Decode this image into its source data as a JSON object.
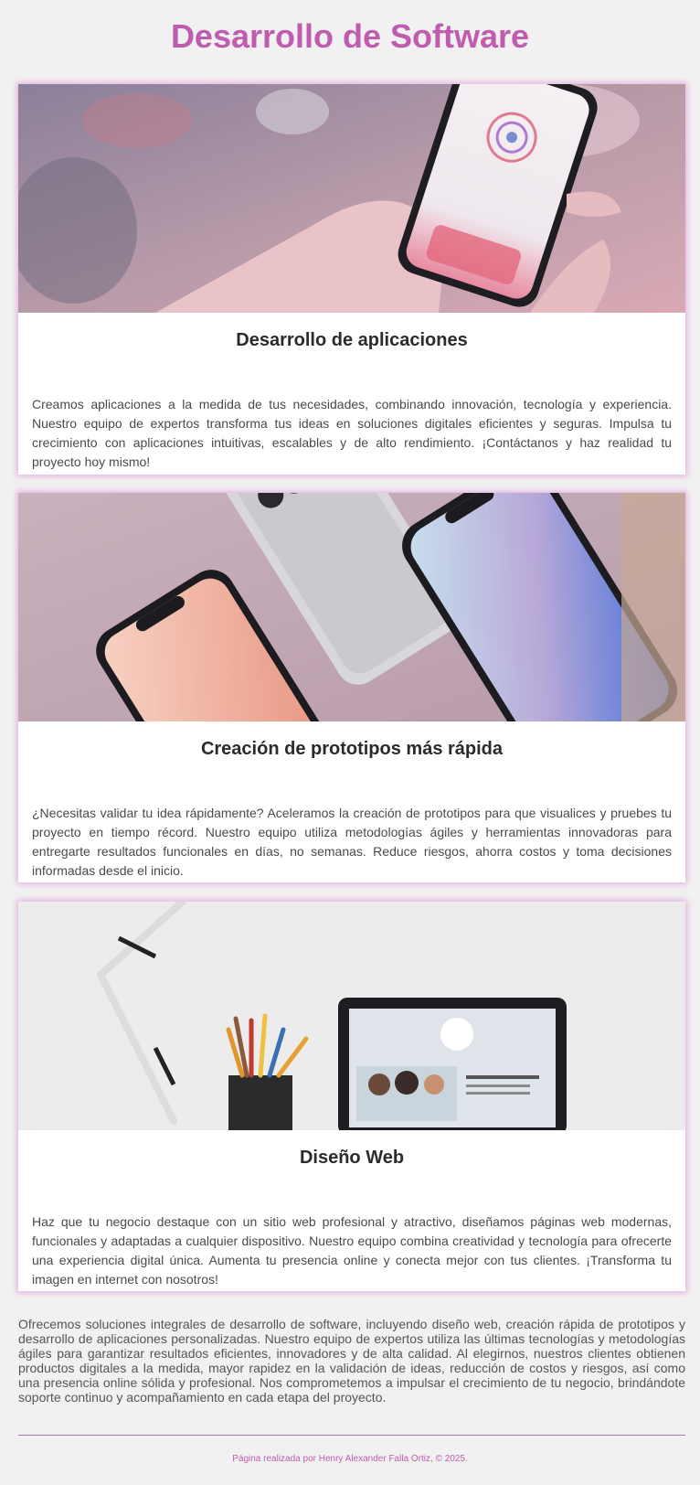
{
  "page": {
    "title": "Desarrollo de Software"
  },
  "cards": [
    {
      "image_alt": "Mano sosteniendo un smartphone con una aplicación",
      "heading": "Desarrollo de aplicaciones",
      "text": "Creamos aplicaciones a la medida de tus necesidades, combinando innovación, tecnología y experiencia. Nuestro equipo de expertos transforma tus ideas en soluciones digitales eficientes y seguras. Impulsa tu crecimiento con aplicaciones intuitivas, escalables y de alto rendimiento. ¡Contáctanos y haz realidad tu proyecto hoy mismo!"
    },
    {
      "image_alt": "Smartphones sobre fondo rosado",
      "heading": "Creación de prototipos más rápida",
      "text": "¿Necesitas validar tu idea rápidamente? Aceleramos la creación de prototipos para que visualices y pruebes tu proyecto en tiempo récord. Nuestro equipo utiliza metodologías ágiles y herramientas innovadoras para entregarte resultados funcionales en días, no semanas. Reduce riesgos, ahorra costos y toma decisiones informadas desde el inicio."
    },
    {
      "image_alt": "Escritorio con lámpara, lápices y tableta mostrando un sitio web",
      "heading": "Diseño Web",
      "text": "Haz que tu negocio destaque con un sitio web profesional y atractivo, diseñamos páginas web modernas, funcionales y adaptadas a cualquier dispositivo. Nuestro equipo combina creatividad y tecnología para ofrecerte una experiencia digital única. Aumenta tu presencia online y conecta mejor con tus clientes. ¡Transforma tu imagen en internet con nosotros!"
    }
  ],
  "summary": "Ofrecemos soluciones integrales de desarrollo de software, incluyendo diseño web, creación rápida de prototipos y desarrollo de aplicaciones personalizadas. Nuestro equipo de expertos utiliza las últimas tecnologías y metodologías ágiles para garantizar resultados eficientes, innovadores y de alta calidad. Al elegirnos, nuestros clientes obtienen productos digitales a la medida, mayor rapidez en la validación de ideas, reducción de costos y riesgos, así como una presencia online sólida y profesional. Nos comprometemos a impulsar el crecimiento de tu negocio, brindándote soporte continuo y acompañamiento en cada etapa del proyecto.",
  "footer": "Página realizada por Henry Alexander Falla Ortiz, © 2025.",
  "colors": {
    "accent": "#c05cb0",
    "background": "#f1f1f1",
    "card": "#ffffff"
  }
}
